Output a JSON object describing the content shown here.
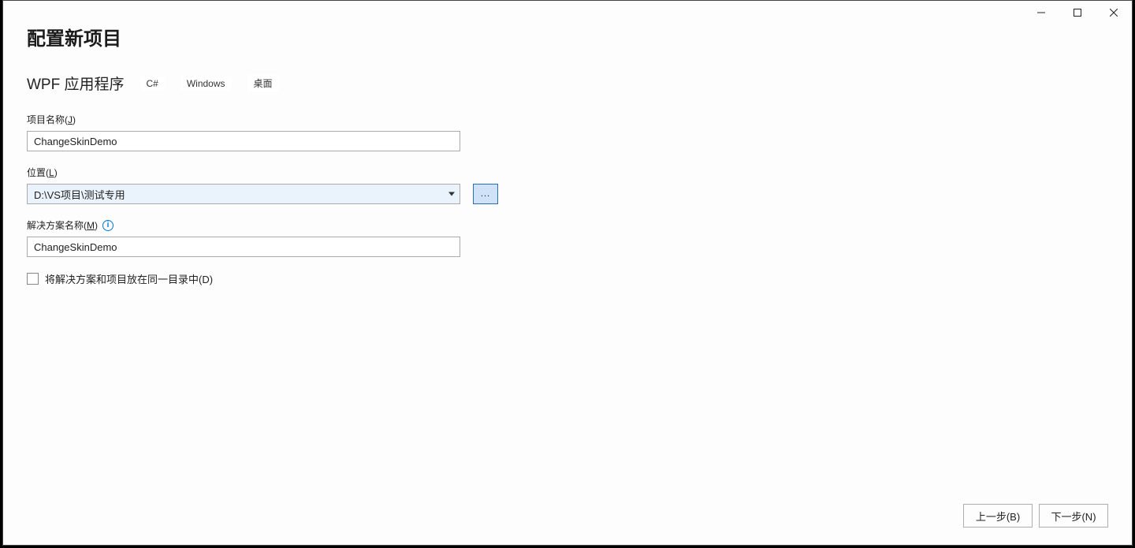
{
  "window": {
    "title": "配置新项目"
  },
  "subtitle": {
    "template_name": "WPF 应用程序",
    "tags": [
      "C#",
      "Windows",
      "桌面"
    ]
  },
  "fields": {
    "project_name": {
      "label_pre": "项目名称(",
      "label_accel": "J",
      "label_post": ")",
      "value": "ChangeSkinDemo"
    },
    "location": {
      "label_pre": "位置(",
      "label_accel": "L",
      "label_post": ")",
      "value": "D:\\VS项目\\测试专用",
      "browse_label": "..."
    },
    "solution_name": {
      "label_pre": "解决方案名称(",
      "label_accel": "M",
      "label_post": ")",
      "value": "ChangeSkinDemo"
    },
    "same_dir": {
      "label_pre": "将解决方案和项目放在同一目录中(",
      "label_accel": "D",
      "label_post": ")",
      "checked": false
    }
  },
  "footer": {
    "back_pre": "上一步(",
    "back_accel": "B",
    "back_post": ")",
    "next_pre": "下一步(",
    "next_accel": "N",
    "next_post": ")"
  }
}
